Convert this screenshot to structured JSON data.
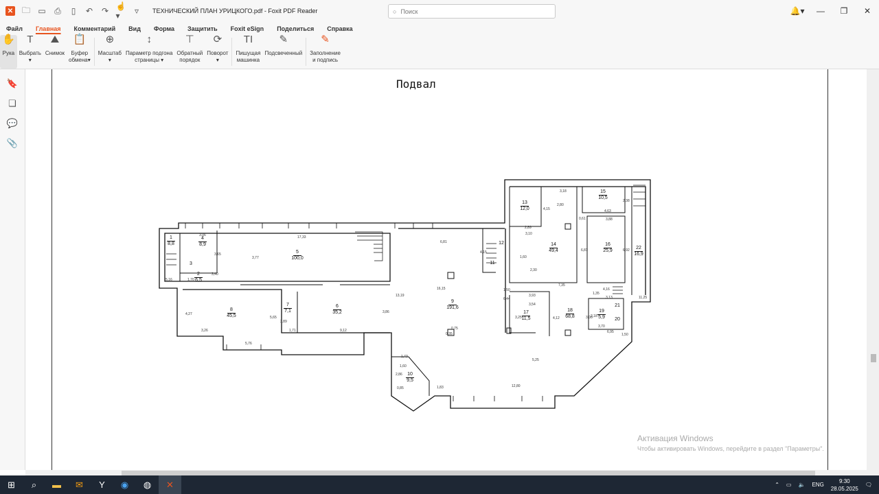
{
  "window": {
    "title": "ТЕХНИЧЕСКИЙ ПЛАН УРИЦКОГО.pdf - Foxit PDF Reader",
    "search_placeholder": "Поиск"
  },
  "menu": [
    "Файл",
    "Главная",
    "Комментарий",
    "Вид",
    "Форма",
    "Защитить",
    "Foxit eSign",
    "Поделиться",
    "Справка"
  ],
  "ribbon": [
    {
      "l1": "Рука",
      "l2": ""
    },
    {
      "l1": "Выбрать",
      "l2": "▾"
    },
    {
      "l1": "Снимок",
      "l2": ""
    },
    {
      "l1": "Буфер",
      "l2": "обмена▾"
    },
    {
      "l1": "Масштаб",
      "l2": "▾"
    },
    {
      "l1": "Параметр подгона",
      "l2": "страницы ▾"
    },
    {
      "l1": "Обратный",
      "l2": "порядок"
    },
    {
      "l1": "Поворот",
      "l2": "▾"
    },
    {
      "l1": "Пишущая",
      "l2": "машинка"
    },
    {
      "l1": "Подсвеченный",
      "l2": ""
    },
    {
      "l1": "Заполнение",
      "l2": "и подпись"
    }
  ],
  "plan": {
    "title": "Подвал",
    "rooms": [
      {
        "n": "1",
        "a": "8,8"
      },
      {
        "n": "2",
        "a": "6,5"
      },
      {
        "n": "3",
        "a": ""
      },
      {
        "n": "4",
        "a": "8,9"
      },
      {
        "n": "5",
        "a": "100,0"
      },
      {
        "n": "6",
        "a": "35,2"
      },
      {
        "n": "7",
        "a": "7,1"
      },
      {
        "n": "8",
        "a": "45,5"
      },
      {
        "n": "9",
        "a": "191,6"
      },
      {
        "n": "10",
        "a": "9,5"
      },
      {
        "n": "11",
        "a": ""
      },
      {
        "n": "12",
        "a": ""
      },
      {
        "n": "13",
        "a": "12,0"
      },
      {
        "n": "14",
        "a": "49,4"
      },
      {
        "n": "15",
        "a": "10,5"
      },
      {
        "n": "16",
        "a": "25,9"
      },
      {
        "n": "17",
        "a": "11,5"
      },
      {
        "n": "18",
        "a": "68,8"
      },
      {
        "n": "19",
        "a": "5,9"
      },
      {
        "n": "20",
        "a": ""
      },
      {
        "n": "21",
        "a": ""
      },
      {
        "n": "22",
        "a": "16,9"
      }
    ],
    "dims": [
      "3,06",
      "17,33",
      "3,77",
      "3,65",
      "3,40",
      "1,70",
      "5,16",
      "4,27",
      "3,26",
      "5,76",
      "5,65",
      "3,89",
      "1,71",
      "9,12",
      "3,86",
      "13,19",
      "6,81",
      "16,15",
      "4,15",
      "0,75",
      "0,35",
      "1,43",
      "1,60",
      "2,86",
      "0,85",
      "1,83",
      "12,80",
      "5,25",
      "6,44",
      "1,50",
      "3,93",
      "3,54",
      "3,25",
      "4,12",
      "7,35",
      "1,60",
      "2,30",
      "2,89",
      "3,10",
      "4,15",
      "3,18",
      "2,80",
      "0,61",
      "4,63",
      "2,38",
      "3,88",
      "6,81",
      "6,92",
      "4,16",
      "1,35",
      "3,13",
      "3,08",
      "2,18",
      "3,70",
      "6,95",
      "1,50",
      "11,25"
    ]
  },
  "activation": {
    "title": "Активация Windows",
    "text": "Чтобы активировать Windows, перейдите в раздел \"Параметры\"."
  },
  "taskbar": {
    "lang": "ENG",
    "time": "9:30",
    "date": "28.05.2025"
  }
}
